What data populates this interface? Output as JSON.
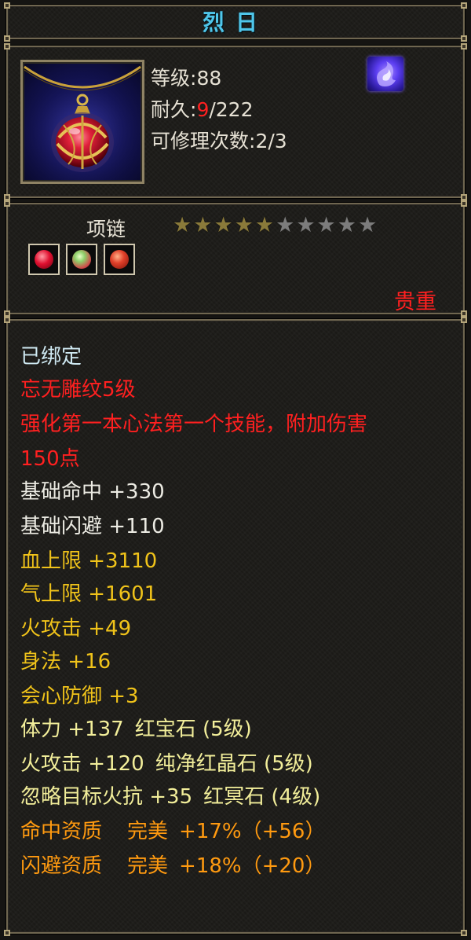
{
  "title": "烈日",
  "item": {
    "icon": "necklace-icon",
    "level_label": "等级:",
    "level": "88",
    "durability_label": "耐久:",
    "durability_current": "9",
    "durability_sep_max": "/222",
    "repair_label": "可修理次数:",
    "repair": "2/3",
    "soul_icon": "soul-flame-icon"
  },
  "mid": {
    "type": "项链",
    "stars_filled": 5,
    "stars_total": 10,
    "gems": [
      "ruby-gem-icon",
      "jade-gem-icon",
      "red-crystal-gem-icon"
    ],
    "rarity": "贵重"
  },
  "attributes": [
    {
      "segs": [
        "已绑定"
      ],
      "color": "#cfe9f2"
    },
    {
      "segs": [
        "忘无雕纹5级"
      ],
      "color": "#ff2020"
    },
    {
      "segs": [
        "强化第一本心法第一个技能，附加伤害"
      ],
      "color": "#ff2020"
    },
    {
      "segs": [
        "150点"
      ],
      "color": "#ff2020"
    },
    {
      "segs": [
        "基础命中 +330"
      ],
      "color": "#ecebe3"
    },
    {
      "segs": [
        "基础闪避 +110"
      ],
      "color": "#ecebe3"
    },
    {
      "segs": [
        "血上限 +3110"
      ],
      "color": "#f0c31a"
    },
    {
      "segs": [
        "气上限 +1601"
      ],
      "color": "#f0c31a"
    },
    {
      "segs": [
        "火攻击 +49"
      ],
      "color": "#f0c31a"
    },
    {
      "segs": [
        "身法 +16"
      ],
      "color": "#f0c31a"
    },
    {
      "segs": [
        "会心防御 +3"
      ],
      "color": "#f0c31a"
    },
    {
      "segs": [
        "体力 +137",
        "红宝石 (5级)"
      ],
      "color": "#f2ee9a"
    },
    {
      "segs": [
        "火攻击 +120",
        "纯净红晶石 (5级)"
      ],
      "color": "#f2ee9a"
    },
    {
      "segs": [
        "忽略目标火抗 +35",
        "红冥石 (4级)"
      ],
      "color": "#f2ee9a"
    },
    {
      "segs": [
        "命中资质",
        "完美",
        "+17%（+56）"
      ],
      "color": "#ff9a10"
    },
    {
      "segs": [
        "闪避资质",
        "完美",
        "+18%（+20）"
      ],
      "color": "#ff9a10"
    }
  ],
  "colors": {
    "title": "#4fc6ea",
    "red": "#ff2020",
    "frame": "#6f6650",
    "background": "#1b1a17"
  }
}
